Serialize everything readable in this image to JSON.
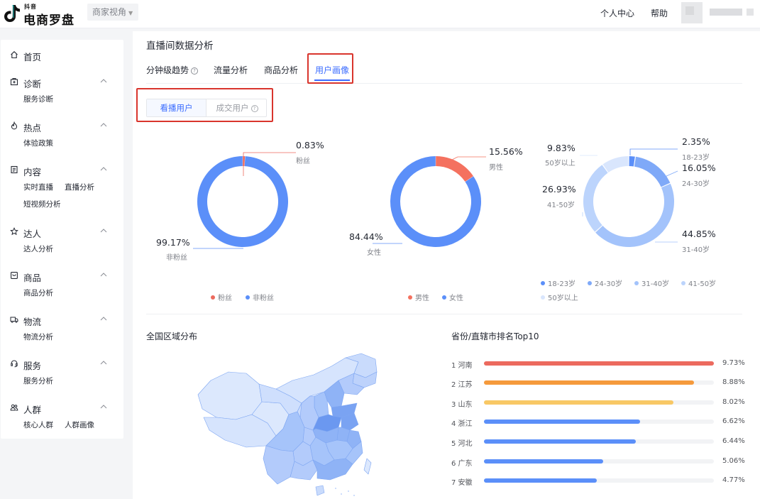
{
  "header": {
    "logo_small": "抖音",
    "logo_main": "电商罗盘",
    "perspective": "商家视角",
    "links": [
      "个人中心",
      "帮助"
    ]
  },
  "sidebar": {
    "sections": [
      {
        "title": "首页",
        "icon": "home-icon",
        "subs": []
      },
      {
        "title": "诊断",
        "icon": "medkit-icon",
        "subs": [
          "服务诊断"
        ]
      },
      {
        "title": "热点",
        "icon": "flame-icon",
        "subs": [
          "体验政策"
        ]
      },
      {
        "title": "内容",
        "icon": "document-icon",
        "subs": [
          "实时直播",
          "直播分析",
          "短视频分析"
        ]
      },
      {
        "title": "达人",
        "icon": "star-icon",
        "subs": [
          "达人分析"
        ]
      },
      {
        "title": "商品",
        "icon": "product-icon",
        "subs": [
          "商品分析"
        ]
      },
      {
        "title": "物流",
        "icon": "truck-icon",
        "subs": [
          "物流分析"
        ]
      },
      {
        "title": "服务",
        "icon": "service-icon",
        "subs": [
          "服务分析"
        ]
      },
      {
        "title": "人群",
        "icon": "crowd-icon",
        "subs": [
          "核心人群",
          "人群画像"
        ]
      }
    ]
  },
  "main": {
    "title": "直播间数据分析",
    "tabs": [
      "分钟级趋势",
      "流量分析",
      "商品分析",
      "用户画像"
    ],
    "active_tab": 3,
    "segments": [
      "看播用户",
      "成交用户"
    ],
    "region_title": "全国区域分布",
    "ranking_title": "省份/直辖市排名Top10"
  },
  "colors": {
    "accent": "#3b6cff",
    "fan": "#ec6a5e",
    "non_fan": "#5b8ff9",
    "male": "#f4715f",
    "female": "#5b8ff9",
    "age": [
      "#5b8ff9",
      "#7fa9f8",
      "#a3c3fb",
      "#bcd4fc",
      "#d9e6fd"
    ]
  },
  "chart_data": [
    {
      "type": "pie",
      "labels": [
        "粉丝",
        "非粉丝"
      ],
      "values": [
        0.83,
        99.17
      ],
      "value_labels": [
        "0.83%",
        "99.17%"
      ],
      "legend": [
        "粉丝",
        "非粉丝"
      ],
      "legend_position": "bottom"
    },
    {
      "type": "pie",
      "labels": [
        "男性",
        "女性"
      ],
      "values": [
        15.56,
        84.44
      ],
      "value_labels": [
        "15.56%",
        "84.44%"
      ],
      "legend": [
        "男性",
        "女性"
      ],
      "legend_position": "bottom"
    },
    {
      "type": "pie",
      "labels": [
        "18-23岁",
        "24-30岁",
        "31-40岁",
        "41-50岁",
        "50岁以上"
      ],
      "values": [
        2.35,
        16.05,
        44.85,
        26.93,
        9.83
      ],
      "value_labels": [
        "2.35%",
        "16.05%",
        "44.85%",
        "26.93%",
        "9.83%"
      ],
      "legend": [
        "18-23岁",
        "24-30岁",
        "31-40岁",
        "41-50岁",
        "50岁以上"
      ],
      "legend_position": "bottom"
    },
    {
      "type": "bar",
      "orientation": "horizontal",
      "categories": [
        "1 河南",
        "2 江苏",
        "3 山东",
        "4 浙江",
        "5 河北",
        "6 广东",
        "7 安徽"
      ],
      "values": [
        9.73,
        8.88,
        8.02,
        6.62,
        6.44,
        5.06,
        4.77
      ],
      "value_labels": [
        "9.73%",
        "8.88%",
        "8.02%",
        "6.62%",
        "6.44%",
        "5.06%",
        "4.77%"
      ],
      "bar_colors": [
        "#ec6a5e",
        "#f59a3c",
        "#f8c865",
        "#5b8ff9",
        "#5b8ff9",
        "#5b8ff9",
        "#5b8ff9"
      ],
      "xlim": [
        0,
        9.73
      ]
    }
  ]
}
